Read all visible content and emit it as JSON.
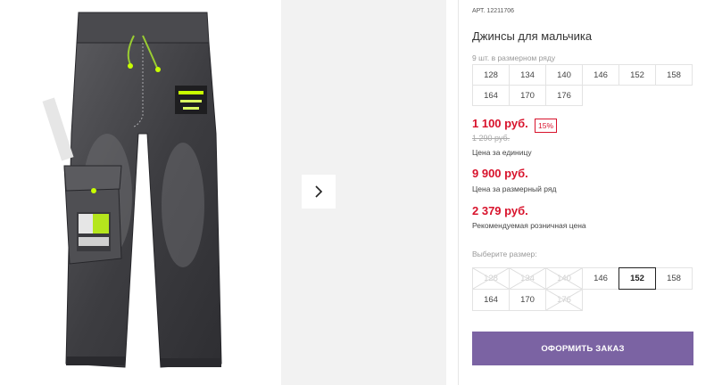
{
  "product": {
    "sku_label": "АРТ.",
    "sku": "12211706",
    "title": "Джинсы для мальчика"
  },
  "size_row": {
    "caption": "9 шт. в размерном ряду",
    "sizes": [
      "128",
      "134",
      "140",
      "146",
      "152",
      "158",
      "164",
      "170",
      "176"
    ]
  },
  "pricing": {
    "unit_price": "1 100 руб.",
    "discount": "15%",
    "old_price": "1 290 руб.",
    "unit_caption": "Цена за единицу",
    "row_price": "9 900 руб.",
    "row_caption": "Цена за размерный ряд",
    "rrp": "2 379 руб.",
    "rrp_caption": "Рекомендуемая розничная цена"
  },
  "size_select": {
    "label": "Выберите размер:",
    "options": [
      {
        "value": "128",
        "available": false
      },
      {
        "value": "134",
        "available": false
      },
      {
        "value": "140",
        "available": false
      },
      {
        "value": "146",
        "available": true
      },
      {
        "value": "152",
        "available": true,
        "selected": true
      },
      {
        "value": "158",
        "available": true
      },
      {
        "value": "164",
        "available": true
      },
      {
        "value": "170",
        "available": true
      },
      {
        "value": "176",
        "available": false
      }
    ]
  },
  "cta": {
    "order_label": "ОФОРМИТЬ ЗАКАЗ"
  },
  "gallery": {
    "next_icon": "chevron-right-icon"
  },
  "colors": {
    "price_red": "#d8132c",
    "button_purple": "#7b63a3"
  }
}
